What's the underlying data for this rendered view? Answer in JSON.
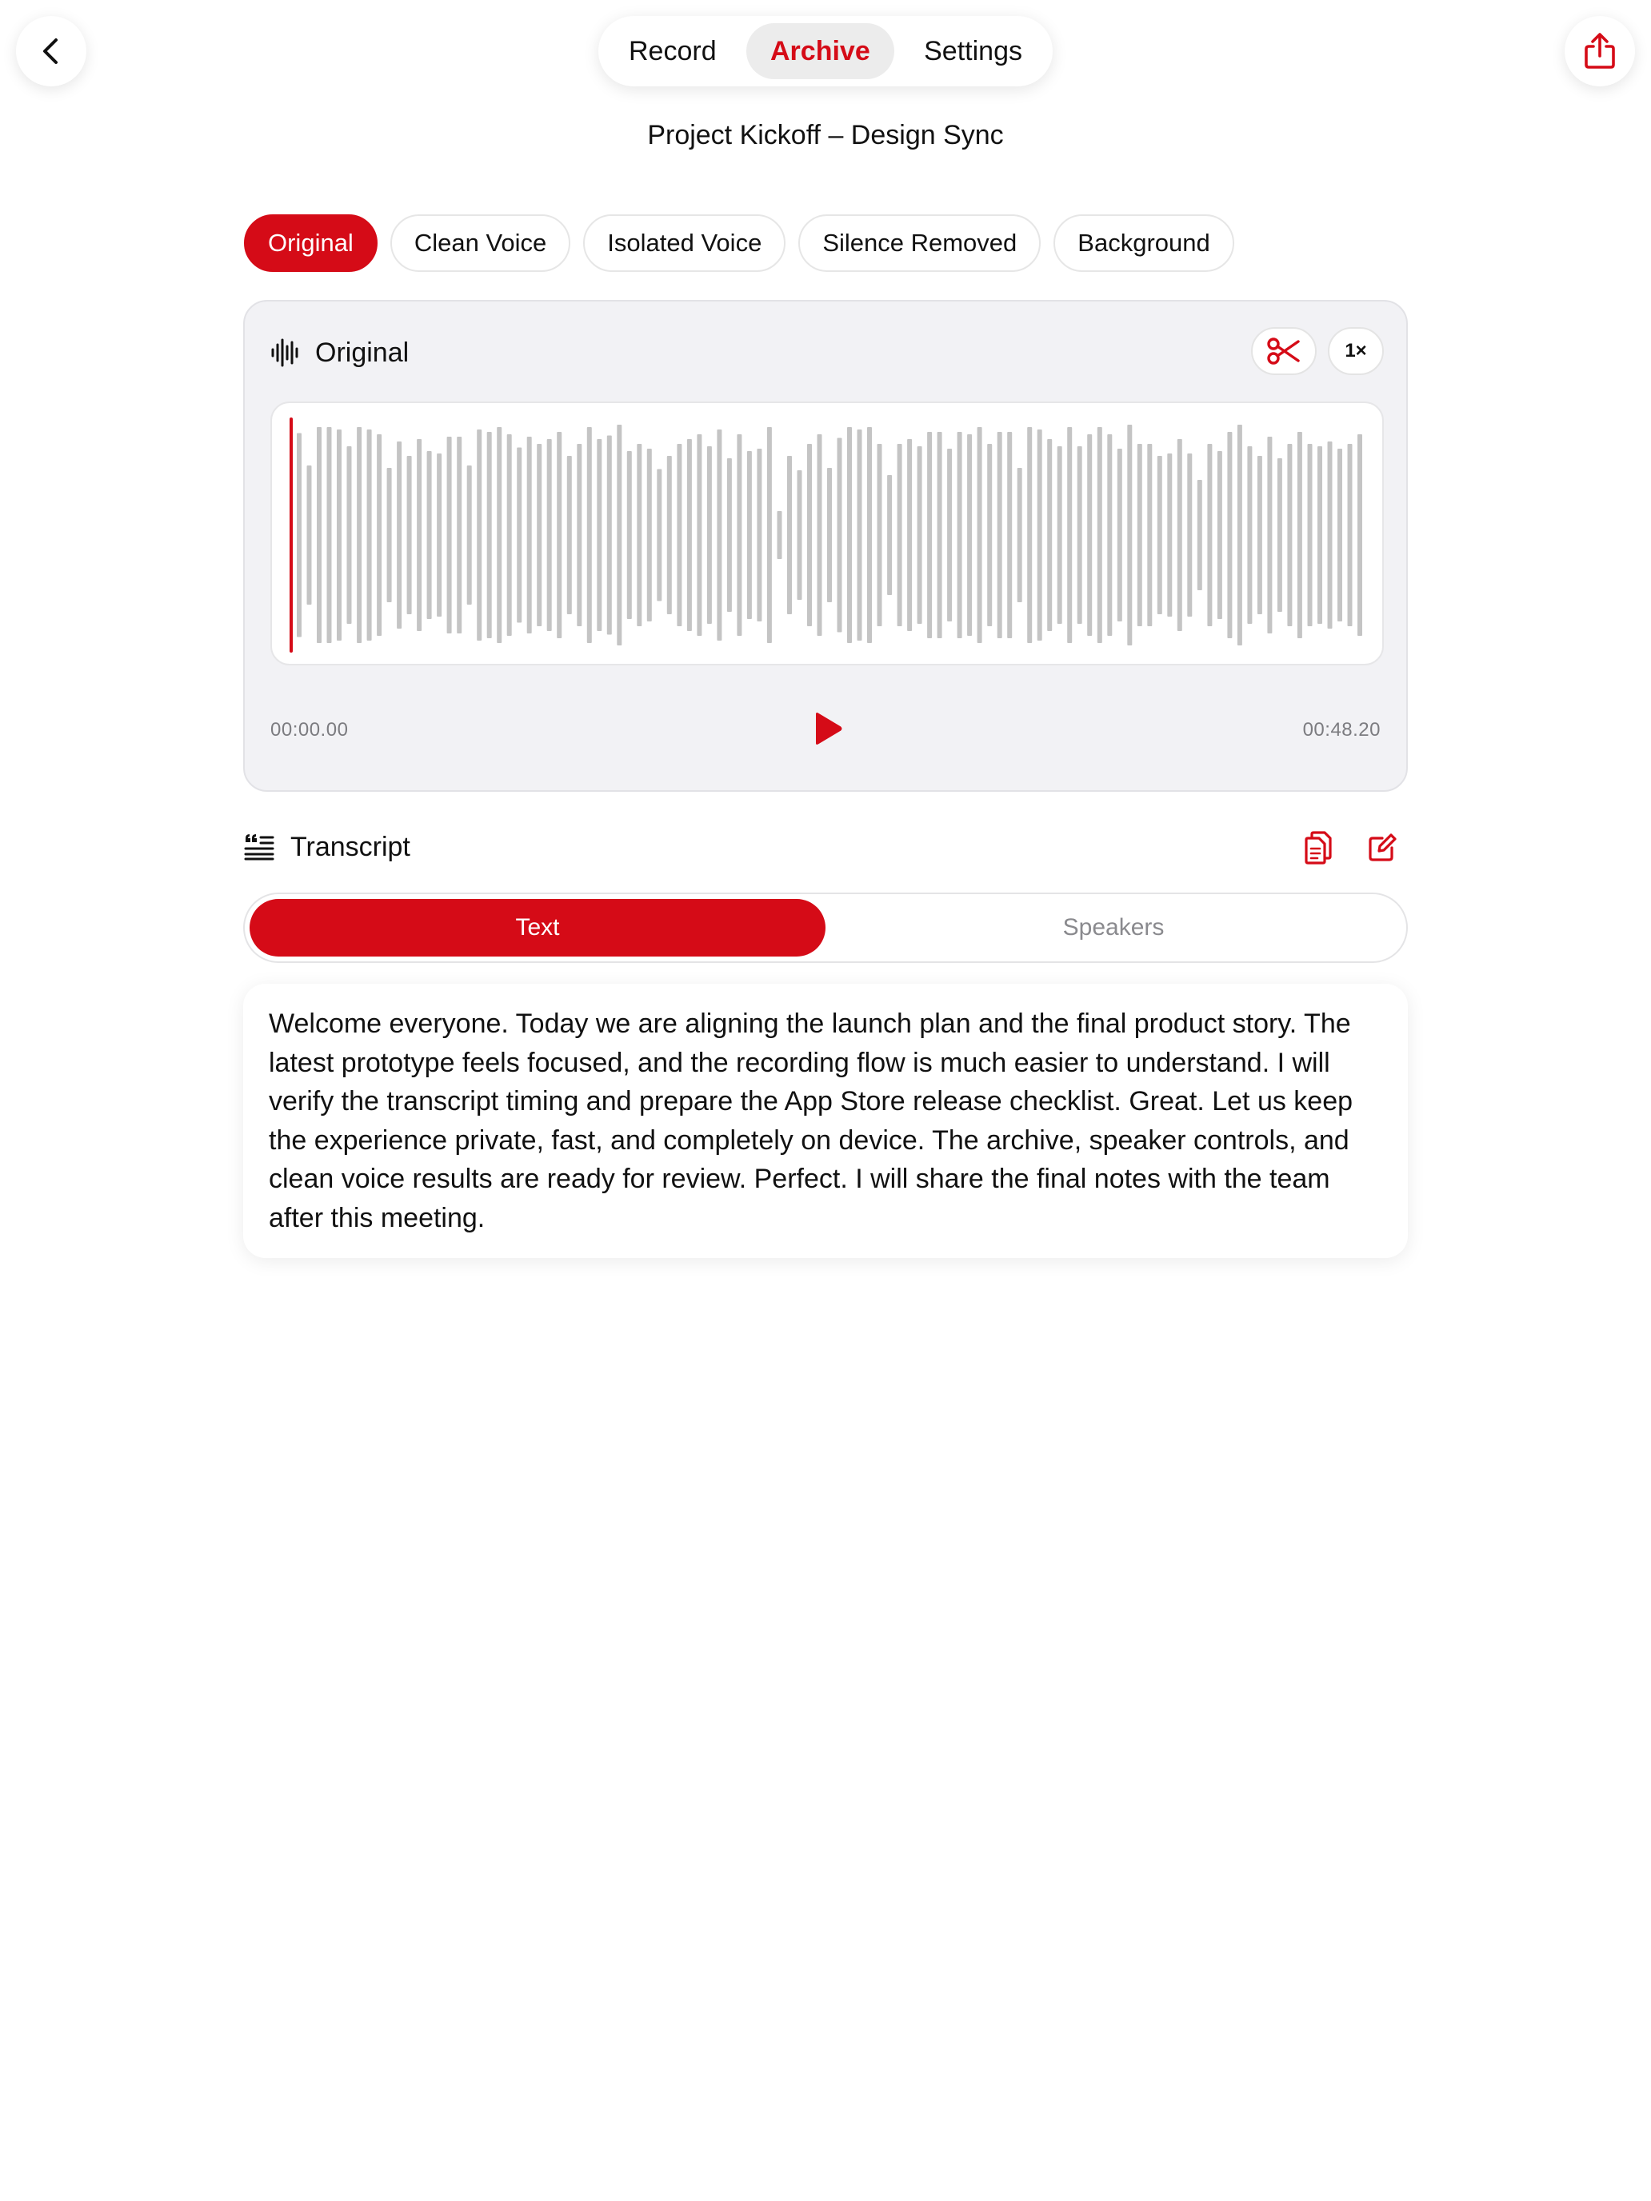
{
  "nav": {
    "segments": [
      {
        "label": "Record",
        "active": false
      },
      {
        "label": "Archive",
        "active": true
      },
      {
        "label": "Settings",
        "active": false
      }
    ]
  },
  "page": {
    "title": "Project Kickoff – Design Sync"
  },
  "versions": [
    {
      "label": "Original",
      "active": true
    },
    {
      "label": "Clean Voice",
      "active": false
    },
    {
      "label": "Isolated Voice",
      "active": false
    },
    {
      "label": "Silence Removed",
      "active": false
    },
    {
      "label": "Background",
      "active": false
    }
  ],
  "player": {
    "title": "Original",
    "speed_label": "1×",
    "time_start": "00:00.00",
    "time_end": "00:48.20",
    "playhead_progress": 0,
    "waveform_levels": [
      0.85,
      0.58,
      0.9,
      0.9,
      0.88,
      0.74,
      0.9,
      0.88,
      0.84,
      0.56,
      0.78,
      0.66,
      0.8,
      0.7,
      0.68,
      0.82,
      0.82,
      0.58,
      0.88,
      0.86,
      0.9,
      0.84,
      0.73,
      0.82,
      0.76,
      0.8,
      0.86,
      0.66,
      0.76,
      0.9,
      0.8,
      0.83,
      0.92,
      0.7,
      0.76,
      0.72,
      0.55,
      0.66,
      0.76,
      0.8,
      0.84,
      0.74,
      0.88,
      0.64,
      0.84,
      0.7,
      0.72,
      0.9,
      0.2,
      0.66,
      0.54,
      0.76,
      0.84,
      0.56,
      0.81,
      0.9,
      0.88,
      0.9,
      0.76,
      0.5,
      0.76,
      0.8,
      0.74,
      0.86,
      0.86,
      0.72,
      0.86,
      0.84,
      0.9,
      0.76,
      0.86,
      0.86,
      0.56,
      0.9,
      0.88,
      0.8,
      0.74,
      0.9,
      0.74,
      0.84,
      0.9,
      0.84,
      0.72,
      0.92,
      0.76,
      0.76,
      0.66,
      0.68,
      0.8,
      0.68,
      0.46,
      0.76,
      0.7,
      0.86,
      0.92,
      0.74,
      0.66,
      0.82,
      0.64,
      0.76,
      0.86,
      0.76,
      0.74,
      0.78,
      0.72,
      0.76,
      0.84
    ]
  },
  "transcript": {
    "title": "Transcript",
    "tabs": [
      {
        "label": "Text",
        "active": true
      },
      {
        "label": "Speakers",
        "active": false
      }
    ],
    "text": "Welcome everyone. Today we are aligning the launch plan and the final product story. The latest prototype feels focused, and the recording flow is much easier to understand. I will verify the transcript timing and prepare the App Store release checklist. Great. Let us keep the experience private, fast, and completely on device. The archive, speaker controls, and clean voice results are ready for review. Perfect. I will share the final notes with the team after this meeting."
  },
  "colors": {
    "accent": "#d50b17",
    "waveform": "#c4c4c4",
    "card_bg": "#f2f2f5"
  },
  "icons": {
    "back": "chevron-left-icon",
    "share": "share-icon",
    "waveform": "waveform-icon",
    "cut": "scissors-icon",
    "play": "play-icon",
    "transcript": "text-quote-icon",
    "copy": "copy-icon",
    "edit": "edit-icon"
  }
}
